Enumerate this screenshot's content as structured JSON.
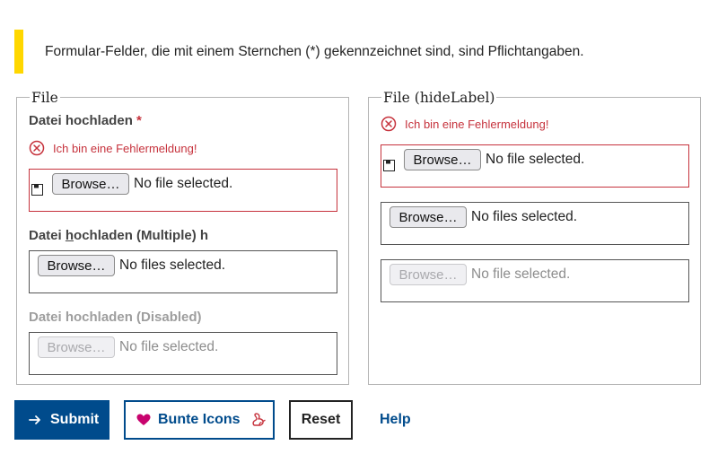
{
  "notice": {
    "text": "Formular-Felder, die mit einem Sternchen (*) gekennzeichnet sind, sind Pflichtangaben.",
    "accent_color": "#ffd700"
  },
  "fieldset_file": {
    "legend": "File",
    "field1": {
      "label": "Datei hochladen",
      "required_marker": "*",
      "error": "Ich bin eine Fehlermeldung!",
      "browse_label": "Browse…",
      "status": "No file selected."
    },
    "field2": {
      "label_prefix": "Datei ",
      "label_accesskey": "h",
      "label_suffix": "ochladen (Multiple) h",
      "browse_label": "Browse…",
      "status": "No files selected."
    },
    "field3": {
      "label": "Datei hochladen (Disabled)",
      "browse_label": "Browse…",
      "status": "No file selected."
    }
  },
  "fieldset_hidelabel": {
    "legend": "File (hideLabel)",
    "field1": {
      "error": "Ich bin eine Fehlermeldung!",
      "browse_label": "Browse…",
      "status": "No file selected."
    },
    "field2": {
      "browse_label": "Browse…",
      "status": "No files selected."
    },
    "field3": {
      "browse_label": "Browse…",
      "status": "No file selected."
    }
  },
  "buttons": {
    "submit": "Submit",
    "colorful": "Bunte Icons",
    "reset": "Reset",
    "help": "Help"
  },
  "colors": {
    "primary": "#004b8c",
    "error": "#c6323c",
    "heart": "#c8036e",
    "squirrel": "#c6323c"
  },
  "icons": {
    "submit": "arrow-right-icon",
    "colorful_left": "heart-icon",
    "colorful_right": "squirrel-icon",
    "error": "error-circle-icon",
    "file": "save-icon"
  }
}
